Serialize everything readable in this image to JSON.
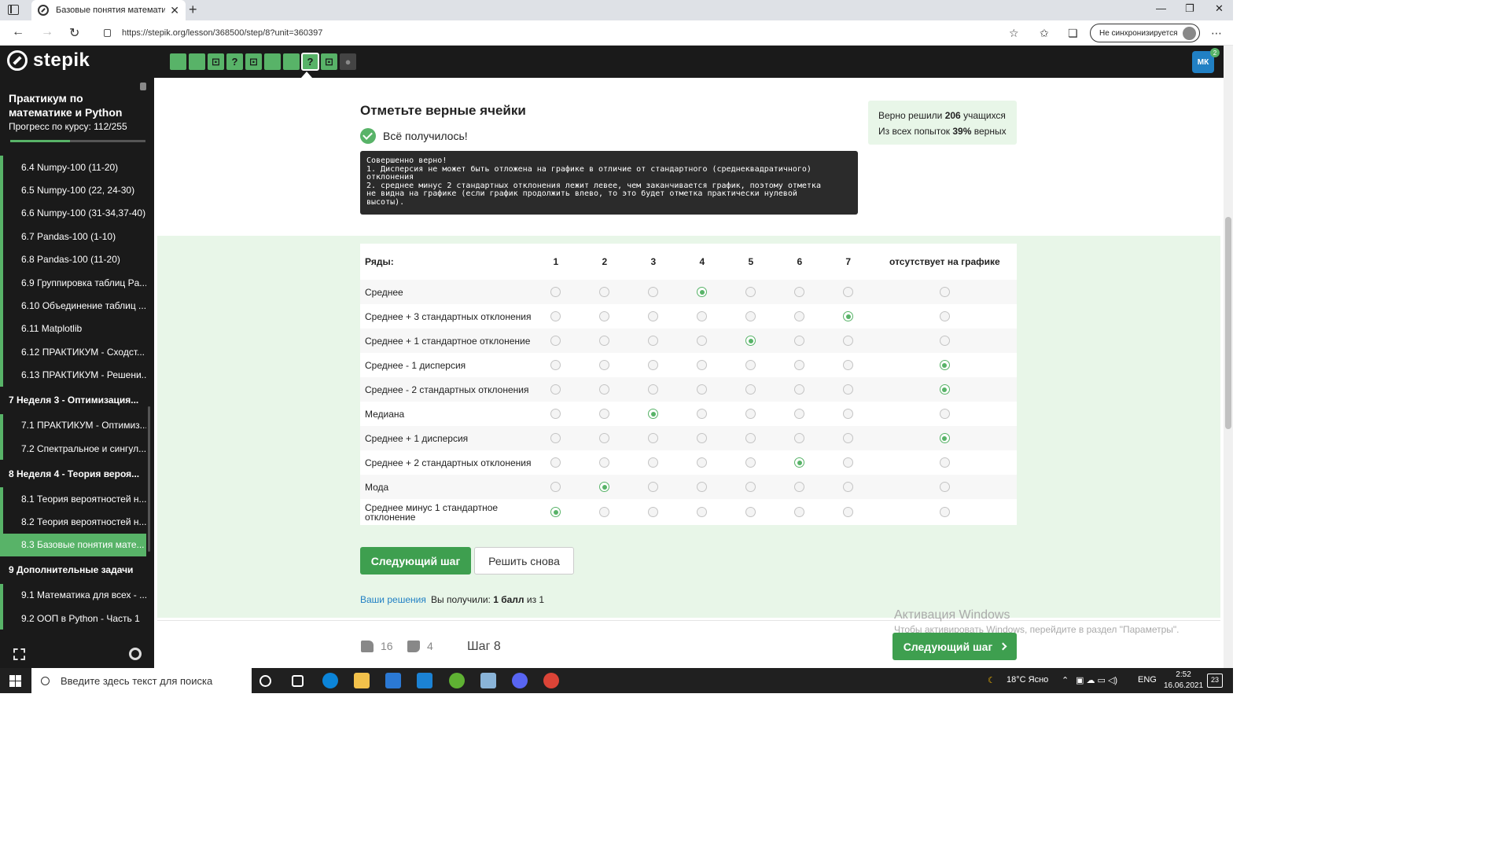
{
  "browser": {
    "tab_title": "Базовые понятия математичес",
    "tab_close": "✕",
    "new_tab": "+",
    "url": "https://stepik.org/lesson/368500/step/8?unit=360397",
    "sync_label": "Не синхронизируется",
    "window_controls": [
      "—",
      "❐",
      "✕"
    ],
    "nav": {
      "back": "←",
      "forward": "→",
      "reload": "↻"
    },
    "toolbar_icons": [
      "☆",
      "✩",
      "❏"
    ],
    "more": "⋯"
  },
  "header": {
    "logo_text": "stepik",
    "steps": [
      {
        "icon": "",
        "state": "done"
      },
      {
        "icon": "",
        "state": "done"
      },
      {
        "icon": "⊡",
        "state": "done"
      },
      {
        "icon": "?",
        "state": "done"
      },
      {
        "icon": "⊡",
        "state": "done"
      },
      {
        "icon": "",
        "state": "done"
      },
      {
        "icon": "",
        "state": "done"
      },
      {
        "icon": "?",
        "state": "current"
      },
      {
        "icon": "⊡",
        "state": "done"
      },
      {
        "icon": "●",
        "state": "grey"
      }
    ],
    "user_initials": "МК",
    "notification_count": "2"
  },
  "sidebar": {
    "course_title": "Практикум по математике и Python",
    "progress_label": "Прогресс по курсу:  112/255",
    "progress_value": 0.44,
    "lessons": [
      {
        "label": "6.4  Numpy-100 (11-20)",
        "type": "lesson"
      },
      {
        "label": "6.5  Numpy-100 (22, 24-30)",
        "type": "lesson"
      },
      {
        "label": "6.6  Numpy-100 (31-34,37-40)",
        "type": "lesson"
      },
      {
        "label": "6.7  Pandas-100 (1-10)",
        "type": "lesson"
      },
      {
        "label": "6.8  Pandas-100 (11-20)",
        "type": "lesson"
      },
      {
        "label": "6.9  Группировка таблиц Pa...",
        "type": "lesson"
      },
      {
        "label": "6.10  Объединение таблиц ...",
        "type": "lesson"
      },
      {
        "label": "6.11  Matplotlib",
        "type": "lesson"
      },
      {
        "label": "6.12  ПРАКТИКУМ - Сходст...",
        "type": "lesson"
      },
      {
        "label": "6.13  ПРАКТИКУМ - Решени...",
        "type": "lesson"
      },
      {
        "label": "7  Неделя 3 - Оптимизация...",
        "type": "section"
      },
      {
        "label": "7.1  ПРАКТИКУМ - Оптимиз...",
        "type": "lesson"
      },
      {
        "label": "7.2  Спектральное и сингул...",
        "type": "lesson"
      },
      {
        "label": "8  Неделя 4 - Теория вероя...",
        "type": "section"
      },
      {
        "label": "8.1  Теория вероятностей н...",
        "type": "lesson"
      },
      {
        "label": "8.2  Теория вероятностей н...",
        "type": "lesson"
      },
      {
        "label": "8.3  Базовые понятия мате...",
        "type": "active"
      },
      {
        "label": "9  Дополнительные задачи",
        "type": "section"
      },
      {
        "label": "9.1  Математика для всех - ...",
        "type": "lesson"
      },
      {
        "label": "9.2  ООП в Python - Часть 1",
        "type": "lesson"
      }
    ]
  },
  "question": {
    "title": "Отметьте верные ячейки",
    "success": "Всё получилось!",
    "feedback": "Совершенно верно!\n1. Дисперсия не может быть отложена на графике в отличие от стандартного (среднеквадратичного)\nотклонения\n2. среднее минус 2 стандартных отклонения лежит левее, чем заканчивается график, поэтому отметка\nне видна на графике (если график продолжить влево, то это будет отметка практически нулевой\nвысоты).",
    "stats_line1_prefix": "Верно решили ",
    "stats_line1_value": "206",
    "stats_line1_suffix": " учащихся",
    "stats_line2_prefix": "Из всех попыток ",
    "stats_line2_value": "39%",
    "stats_line2_suffix": " верных"
  },
  "table": {
    "row_header": "Ряды:",
    "columns": [
      "1",
      "2",
      "3",
      "4",
      "5",
      "6",
      "7",
      "отсутствует на графике"
    ],
    "rows": [
      {
        "label": "Среднее",
        "selected": 4
      },
      {
        "label": "Среднее + 3 стандартных отклонения",
        "selected": 7
      },
      {
        "label": "Среднее + 1 стандартное отклонение",
        "selected": 5
      },
      {
        "label": "Среднее - 1 дисперсия",
        "selected": 8
      },
      {
        "label": "Среднее - 2 стандартных отклонения",
        "selected": 8
      },
      {
        "label": "Медиана",
        "selected": 3
      },
      {
        "label": "Среднее + 1 дисперсия",
        "selected": 8
      },
      {
        "label": "Среднее + 2 стандартных отклонения",
        "selected": 6
      },
      {
        "label": "Мода",
        "selected": 2
      },
      {
        "label": "Среднее минус 1 стандартное отклонение",
        "selected": 1
      }
    ]
  },
  "actions": {
    "next_step": "Следующий шаг",
    "retry": "Решить снова",
    "your_solutions": "Ваши решения",
    "score_prefix": "Вы получили: ",
    "score_value": "1 балл",
    "score_suffix": " из 1"
  },
  "footer": {
    "likes": "16",
    "dislikes": "4",
    "step_label": "Шаг 8",
    "next_step": "Следующий шаг"
  },
  "watermark": {
    "title": "Активация Windows",
    "subtitle": "Чтобы активировать Windows, перейдите в раздел \"Параметры\"."
  },
  "taskbar": {
    "search_placeholder": "Введите здесь текст для поиска",
    "weather": "18°C  Ясно",
    "language": "ENG",
    "time": "2:52",
    "date": "16.06.2021",
    "notifications": "23"
  },
  "colors": {
    "accent": "#58b368",
    "button": "#3e9f4f",
    "link": "#2180c4",
    "dark": "#1a1a1a"
  }
}
